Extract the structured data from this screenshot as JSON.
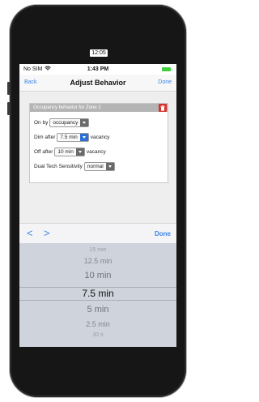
{
  "clock_tag": "12:05",
  "status": {
    "carrier": "No SIM",
    "time": "1:43 PM"
  },
  "nav": {
    "back": "Back",
    "title": "Adjust Behavior",
    "done": "Done"
  },
  "panel": {
    "header": "Occupancy behavior for Zone 1",
    "rows": {
      "on_by": {
        "label": "On by",
        "value": "occupancy"
      },
      "dim_after": {
        "label": "Dim after",
        "value": "7.5 min",
        "suffix": "vacancy"
      },
      "off_after": {
        "label": "Off after",
        "value": "10 min",
        "suffix": "vacancy"
      },
      "sensitivity": {
        "label": "Dual Tech Sensitivity",
        "value": "normal"
      }
    }
  },
  "toolbar": {
    "prev": "<",
    "next": ">",
    "done": "Done"
  },
  "picker": {
    "options": [
      "15 min",
      "12.5 min",
      "10 min",
      "7.5 min",
      "5 min",
      "2.5 min",
      "30 s"
    ],
    "selected": "7.5 min"
  },
  "colors": {
    "accent": "#3b86e8",
    "trash": "#d9302b",
    "battery": "#3fcf3f"
  }
}
